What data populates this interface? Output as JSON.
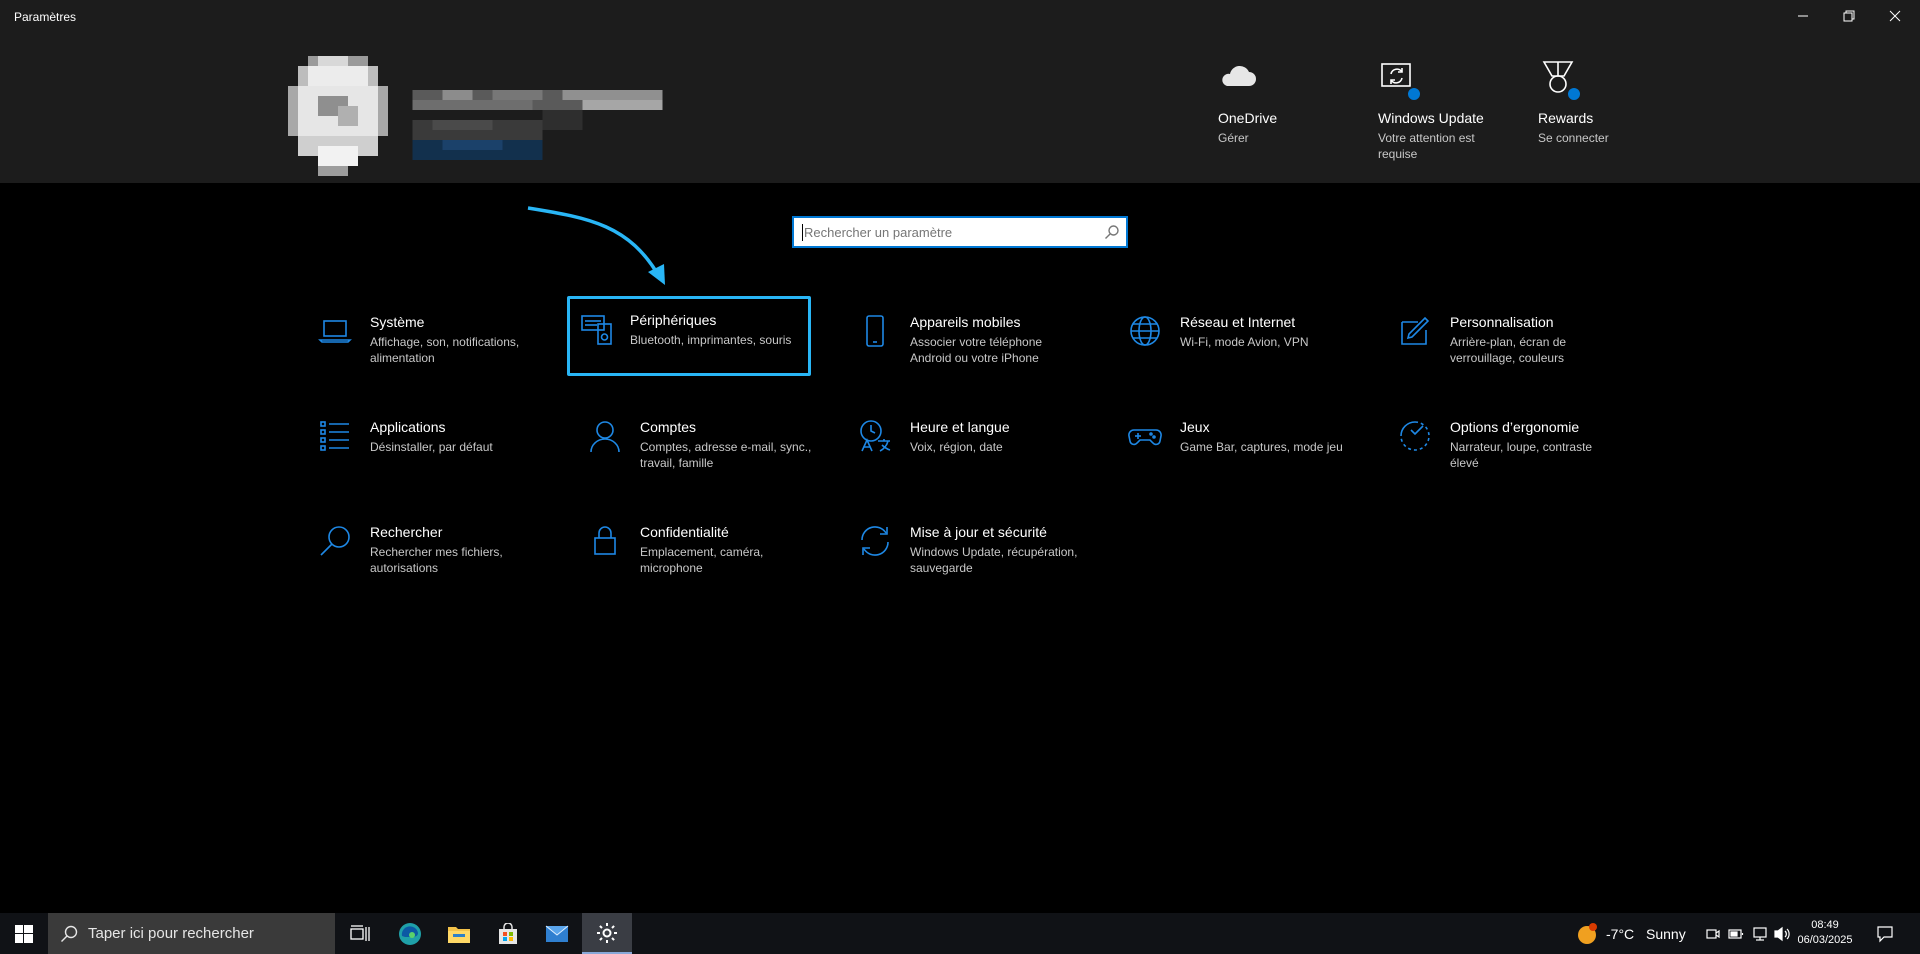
{
  "window": {
    "title": "Paramètres"
  },
  "header": {
    "quick_links": [
      {
        "title": "OneDrive",
        "subtitle": "Gérer",
        "icon": "cloud-icon"
      },
      {
        "title": "Windows Update",
        "subtitle": "Votre attention est requise",
        "icon": "windows-update-icon"
      },
      {
        "title": "Rewards",
        "subtitle": "Se connecter",
        "icon": "rewards-medal-icon"
      }
    ]
  },
  "search": {
    "placeholder": "Rechercher un paramètre"
  },
  "categories": [
    {
      "title": "Système",
      "desc": "Affichage, son, notifications, alimentation",
      "icon": "laptop-icon"
    },
    {
      "title": "Périphériques",
      "desc": "Bluetooth, imprimantes, souris",
      "icon": "devices-icon"
    },
    {
      "title": "Appareils mobiles",
      "desc": "Associer votre téléphone Android ou votre iPhone",
      "icon": "phone-icon"
    },
    {
      "title": "Réseau et Internet",
      "desc": "Wi-Fi, mode Avion, VPN",
      "icon": "globe-icon"
    },
    {
      "title": "Personnalisation",
      "desc": "Arrière-plan, écran de verrouillage, couleurs",
      "icon": "personalization-icon"
    },
    {
      "title": "Applications",
      "desc": "Désinstaller, par défaut",
      "icon": "apps-list-icon"
    },
    {
      "title": "Comptes",
      "desc": "Comptes, adresse e-mail, sync., travail, famille",
      "icon": "person-icon"
    },
    {
      "title": "Heure et langue",
      "desc": "Voix, région, date",
      "icon": "time-language-icon"
    },
    {
      "title": "Jeux",
      "desc": "Game Bar, captures, mode jeu",
      "icon": "gamepad-icon"
    },
    {
      "title": "Options d’ergonomie",
      "desc": "Narrateur, loupe, contraste élevé",
      "icon": "ease-of-access-icon"
    },
    {
      "title": "Rechercher",
      "desc": "Rechercher mes fichiers, autorisations",
      "icon": "search-icon"
    },
    {
      "title": "Confidentialité",
      "desc": "Emplacement, caméra, microphone",
      "icon": "lock-icon"
    },
    {
      "title": "Mise à jour et sécurité",
      "desc": "Windows Update, récupération, sauvegarde",
      "icon": "sync-icon"
    }
  ],
  "taskbar": {
    "search_placeholder": "Taper ici pour rechercher",
    "weather": {
      "temp": "-7°C",
      "condition": "Sunny"
    },
    "clock": {
      "time": "08:49",
      "date": "06/03/2025"
    }
  },
  "colors": {
    "accent": "#0078d4",
    "icon_blue": "#1e88e5",
    "highlight": "#29b6f6"
  }
}
